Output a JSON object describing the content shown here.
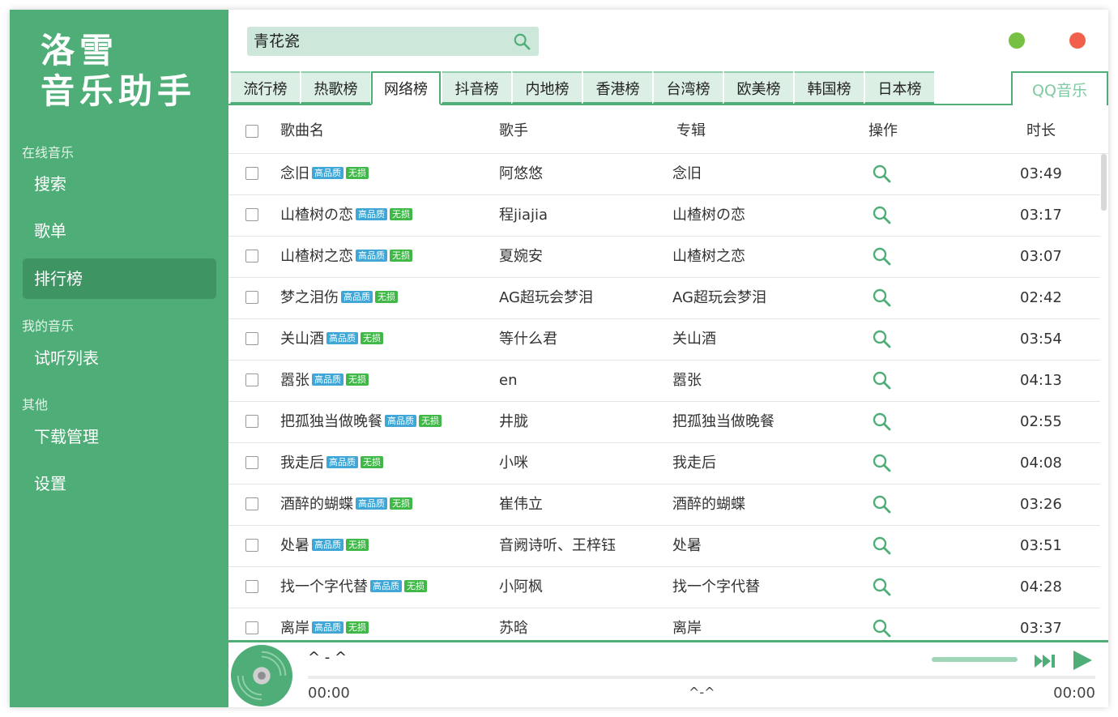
{
  "app": {
    "logo_line1": "洛雪",
    "logo_line2": "音乐助手"
  },
  "sidebar": {
    "sections": [
      {
        "label": "在线音乐"
      },
      {
        "label": "我的音乐"
      },
      {
        "label": "其他"
      }
    ],
    "items": [
      {
        "label": "搜索",
        "active": false
      },
      {
        "label": "歌单",
        "active": false
      },
      {
        "label": "排行榜",
        "active": true
      },
      {
        "label": "试听列表",
        "active": false
      },
      {
        "label": "下载管理",
        "active": false
      },
      {
        "label": "设置",
        "active": false
      }
    ]
  },
  "search": {
    "value": "青花瓷",
    "icon": "search-icon"
  },
  "window_controls": {
    "minimize_color": "#76c043",
    "close_color": "#f0604a"
  },
  "tabs": [
    {
      "label": "流行榜",
      "active": false
    },
    {
      "label": "热歌榜",
      "active": false
    },
    {
      "label": "网络榜",
      "active": true
    },
    {
      "label": "抖音榜",
      "active": false
    },
    {
      "label": "内地榜",
      "active": false
    },
    {
      "label": "香港榜",
      "active": false
    },
    {
      "label": "台湾榜",
      "active": false
    },
    {
      "label": "欧美榜",
      "active": false
    },
    {
      "label": "韩国榜",
      "active": false
    },
    {
      "label": "日本榜",
      "active": false
    }
  ],
  "source_tab": "QQ音乐",
  "table": {
    "headers": {
      "name": "歌曲名",
      "singer": "歌手",
      "album": "专辑",
      "action": "操作",
      "duration": "时长"
    },
    "tag_hq": "高品质",
    "tag_lossless": "无损",
    "rows": [
      {
        "name": "念旧",
        "singer": "阿悠悠",
        "album": "念旧",
        "duration": "03:49"
      },
      {
        "name": "山楂树の恋",
        "singer": "程jiajia",
        "album": "山楂树の恋",
        "duration": "03:17"
      },
      {
        "name": "山楂树之恋",
        "singer": "夏婉安",
        "album": "山楂树之恋",
        "duration": "03:07"
      },
      {
        "name": "梦之泪伤",
        "singer": "AG超玩会梦泪",
        "album": "AG超玩会梦泪",
        "duration": "02:42"
      },
      {
        "name": "关山酒",
        "singer": "等什么君",
        "album": "关山酒",
        "duration": "03:54"
      },
      {
        "name": "嚣张",
        "singer": "en",
        "album": "嚣张",
        "duration": "04:13"
      },
      {
        "name": "把孤独当做晚餐",
        "singer": "井胧",
        "album": "把孤独当做晚餐",
        "duration": "02:55"
      },
      {
        "name": "我走后",
        "singer": "小咪",
        "album": "我走后",
        "duration": "04:08"
      },
      {
        "name": "酒醉的蝴蝶",
        "singer": "崔伟立",
        "album": "酒醉的蝴蝶",
        "duration": "03:26"
      },
      {
        "name": "处暑",
        "singer": "音阙诗听、王梓钰",
        "album": "处暑",
        "duration": "03:51"
      },
      {
        "name": "找一个字代替",
        "singer": "小阿枫",
        "album": "找一个字代替",
        "duration": "04:28"
      },
      {
        "name": "离岸",
        "singer": "苏晗",
        "album": "离岸",
        "duration": "03:37"
      }
    ]
  },
  "player": {
    "title": "^ - ^",
    "current_time": "00:00",
    "status": "^-^",
    "total_time": "00:00",
    "progress": 0,
    "accent": "#4fae78"
  }
}
